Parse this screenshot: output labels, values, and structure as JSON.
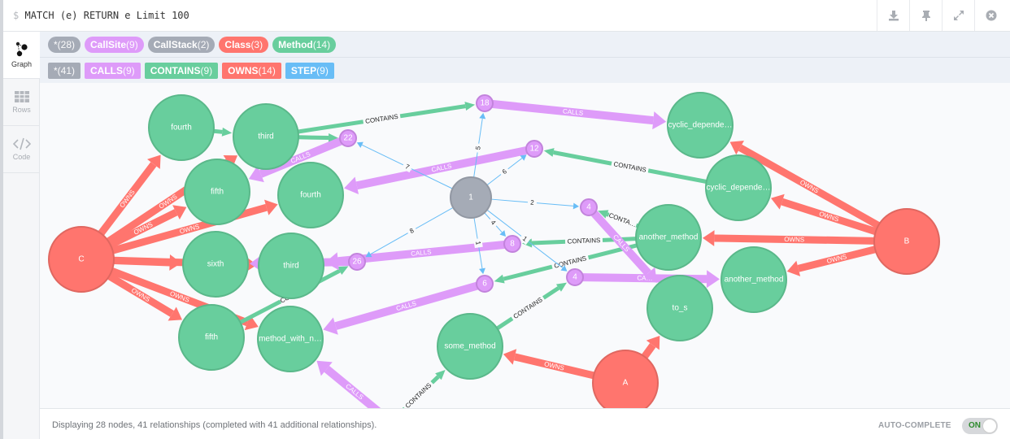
{
  "query": {
    "prompt": "$",
    "text": "MATCH (e) RETURN e Limit 100"
  },
  "toolbar": [
    {
      "name": "download-icon",
      "label": "download"
    },
    {
      "name": "pin-icon",
      "label": "pin"
    },
    {
      "name": "expand-icon",
      "label": "expand"
    },
    {
      "name": "close-icon",
      "label": "close"
    }
  ],
  "sidebar": {
    "tabs": [
      {
        "label": "Graph",
        "icon": "graph-icon",
        "active": true
      },
      {
        "label": "Rows",
        "icon": "table-icon",
        "active": false
      },
      {
        "label": "Code",
        "icon": "code-icon",
        "active": false
      }
    ]
  },
  "node_labels": [
    {
      "name": "*",
      "count": "(28)",
      "color": "#a5abb6"
    },
    {
      "name": "CallSite",
      "count": "(9)",
      "color": "#de9bf9"
    },
    {
      "name": "CallStack",
      "count": "(2)",
      "color": "#a5abb6"
    },
    {
      "name": "Class",
      "count": "(3)",
      "color": "#ff756e"
    },
    {
      "name": "Method",
      "count": "(14)",
      "color": "#68ce9d"
    }
  ],
  "rel_types": [
    {
      "name": "*",
      "count": "(41)",
      "color": "#a5abb6"
    },
    {
      "name": "CALLS",
      "count": "(9)",
      "color": "#de9bf9"
    },
    {
      "name": "CONTAINS",
      "count": "(9)",
      "color": "#68ce9d"
    },
    {
      "name": "OWNS",
      "count": "(14)",
      "color": "#ff756e"
    },
    {
      "name": "STEP",
      "count": "(9)",
      "color": "#68bdf6"
    }
  ],
  "colors": {
    "Class": "#ff756e",
    "Class_border": "#e06760",
    "Method": "#68ce9d",
    "Method_border": "#5ab88a",
    "CallSite": "#de9bf9",
    "CallSite_border": "#c283dc",
    "CallStack": "#a5abb6",
    "CallStack_border": "#9298a3",
    "OWNS": "#ff756e",
    "CONTAINS": "#68ce9d",
    "CALLS": "#de9bf9",
    "STEP": "#68bdf6"
  },
  "graph": {
    "nodes": [
      {
        "id": "C",
        "label": "C",
        "type": "Class"
      },
      {
        "id": "B",
        "label": "B",
        "type": "Class"
      },
      {
        "id": "A",
        "label": "A",
        "type": "Class"
      },
      {
        "id": "m_fourth1",
        "label": "fourth",
        "type": "Method"
      },
      {
        "id": "m_third1",
        "label": "third",
        "type": "Method"
      },
      {
        "id": "m_fifth1",
        "label": "fifth",
        "type": "Method"
      },
      {
        "id": "m_fourth2",
        "label": "fourth",
        "type": "Method"
      },
      {
        "id": "m_sixth",
        "label": "sixth",
        "type": "Method"
      },
      {
        "id": "m_third2",
        "label": "third",
        "type": "Method"
      },
      {
        "id": "m_fifth2",
        "label": "fifth",
        "type": "Method"
      },
      {
        "id": "m_mwn",
        "label": "method_with_n…",
        "type": "Method"
      },
      {
        "id": "m_some",
        "label": "some_method",
        "type": "Method"
      },
      {
        "id": "m_cyc1",
        "label": "cyclic_depende…",
        "type": "Method"
      },
      {
        "id": "m_cyc2",
        "label": "cyclic_depende…",
        "type": "Method"
      },
      {
        "id": "m_another1",
        "label": "another_method",
        "type": "Method"
      },
      {
        "id": "m_another2",
        "label": "another_method",
        "type": "Method"
      },
      {
        "id": "m_to_s",
        "label": "to_s",
        "type": "Method"
      },
      {
        "id": "cs18",
        "label": "18",
        "type": "CallSite"
      },
      {
        "id": "cs22",
        "label": "22",
        "type": "CallSite"
      },
      {
        "id": "cs12",
        "label": "12",
        "type": "CallSite"
      },
      {
        "id": "cs4a",
        "label": "4",
        "type": "CallSite"
      },
      {
        "id": "cs8",
        "label": "8",
        "type": "CallSite"
      },
      {
        "id": "cs26",
        "label": "26",
        "type": "CallSite"
      },
      {
        "id": "cs6",
        "label": "6",
        "type": "CallSite"
      },
      {
        "id": "cs4b",
        "label": "4",
        "type": "CallSite"
      },
      {
        "id": "stack1",
        "label": "1",
        "type": "CallStack"
      }
    ],
    "relationships": [
      {
        "from": "C",
        "to": "m_fourth1",
        "type": "OWNS",
        "label": "OWNS"
      },
      {
        "from": "C",
        "to": "m_third1",
        "type": "OWNS",
        "label": "OWNS"
      },
      {
        "from": "C",
        "to": "m_fifth1",
        "type": "OWNS",
        "label": "OWNS"
      },
      {
        "from": "C",
        "to": "m_fourth2",
        "type": "OWNS",
        "label": "OWNS"
      },
      {
        "from": "C",
        "to": "m_sixth",
        "type": "OWNS",
        "label": "OWNS"
      },
      {
        "from": "C",
        "to": "m_fifth2",
        "type": "OWNS",
        "label": "OWNS"
      },
      {
        "from": "C",
        "to": "m_mwn",
        "type": "OWNS",
        "label": "OWNS"
      },
      {
        "from": "C",
        "to": "m_third2",
        "type": "OWNS",
        "label": ""
      },
      {
        "from": "B",
        "to": "m_cyc1",
        "type": "OWNS",
        "label": "OWNS"
      },
      {
        "from": "B",
        "to": "m_cyc2",
        "type": "OWNS",
        "label": "OWNS"
      },
      {
        "from": "B",
        "to": "m_another1",
        "type": "OWNS",
        "label": "OWNS"
      },
      {
        "from": "B",
        "to": "m_another2",
        "type": "OWNS",
        "label": "OWNS"
      },
      {
        "from": "A",
        "to": "m_some",
        "type": "OWNS",
        "label": "OWNS"
      },
      {
        "from": "A",
        "to": "m_to_s",
        "type": "OWNS",
        "label": ""
      },
      {
        "from": "m_third1",
        "to": "cs18",
        "type": "CONTAINS",
        "label": "CONTAINS"
      },
      {
        "from": "m_third1",
        "to": "cs22",
        "type": "CONTAINS",
        "label": ""
      },
      {
        "from": "m_fourth1",
        "to": "m_third1",
        "type": "CONTAINS",
        "label": ""
      },
      {
        "from": "m_cyc2",
        "to": "cs12",
        "type": "CONTAINS",
        "label": "CONTAINS"
      },
      {
        "from": "m_another1",
        "to": "cs4a",
        "type": "CONTAINS",
        "label": "CONTA…"
      },
      {
        "from": "m_another1",
        "to": "cs8",
        "type": "CONTAINS",
        "label": "CONTAINS"
      },
      {
        "from": "m_another1",
        "to": "cs6",
        "type": "CONTAINS",
        "label": "CONTAINS"
      },
      {
        "from": "m_some",
        "to": "cs4b",
        "type": "CONTAINS",
        "label": "CONTAINS"
      },
      {
        "from": "m_fifth2",
        "to": "cs26",
        "type": "CONTAINS",
        "label": "CON…"
      },
      {
        "from": "bottom_off",
        "to": "m_some",
        "type": "CONTAINS",
        "label": "CONTAINS"
      },
      {
        "from": "cs18",
        "to": "m_cyc1",
        "type": "CALLS",
        "label": "CALLS"
      },
      {
        "from": "cs22",
        "to": "m_fifth1",
        "type": "CALLS",
        "label": "CALLS"
      },
      {
        "from": "cs12",
        "to": "m_fourth2",
        "type": "CALLS",
        "label": "CALLS"
      },
      {
        "from": "cs4a",
        "to": "m_to_s",
        "type": "CALLS",
        "label": "CALLS"
      },
      {
        "from": "cs8",
        "to": "m_third2",
        "type": "CALLS",
        "label": "CALLS"
      },
      {
        "from": "cs26",
        "to": "m_sixth",
        "type": "CALLS",
        "label": ""
      },
      {
        "from": "cs6",
        "to": "m_mwn",
        "type": "CALLS",
        "label": "CALLS"
      },
      {
        "from": "cs4b",
        "to": "m_another2",
        "type": "CALLS",
        "label": "CA…"
      },
      {
        "from": "bottom_off2",
        "to": "m_mwn",
        "type": "CALLS",
        "label": "CALLS"
      },
      {
        "from": "stack1",
        "to": "cs18",
        "type": "STEP",
        "label": "5"
      },
      {
        "from": "stack1",
        "to": "cs22",
        "type": "STEP",
        "label": "7"
      },
      {
        "from": "stack1",
        "to": "cs12",
        "type": "STEP",
        "label": "6"
      },
      {
        "from": "stack1",
        "to": "cs4a",
        "type": "STEP",
        "label": "2"
      },
      {
        "from": "stack1",
        "to": "cs8",
        "type": "STEP",
        "label": "4"
      },
      {
        "from": "stack1",
        "to": "cs26",
        "type": "STEP",
        "label": "8"
      },
      {
        "from": "stack1",
        "to": "cs6",
        "type": "STEP",
        "label": "1"
      },
      {
        "from": "stack1",
        "to": "cs4b",
        "type": "STEP",
        "label": "1"
      }
    ]
  },
  "status": {
    "text": "Displaying 28 nodes, 41 relationships (completed with 41 additional relationships).",
    "autocomplete_label": "AUTO-COMPLETE",
    "autocomplete_state": "ON"
  }
}
